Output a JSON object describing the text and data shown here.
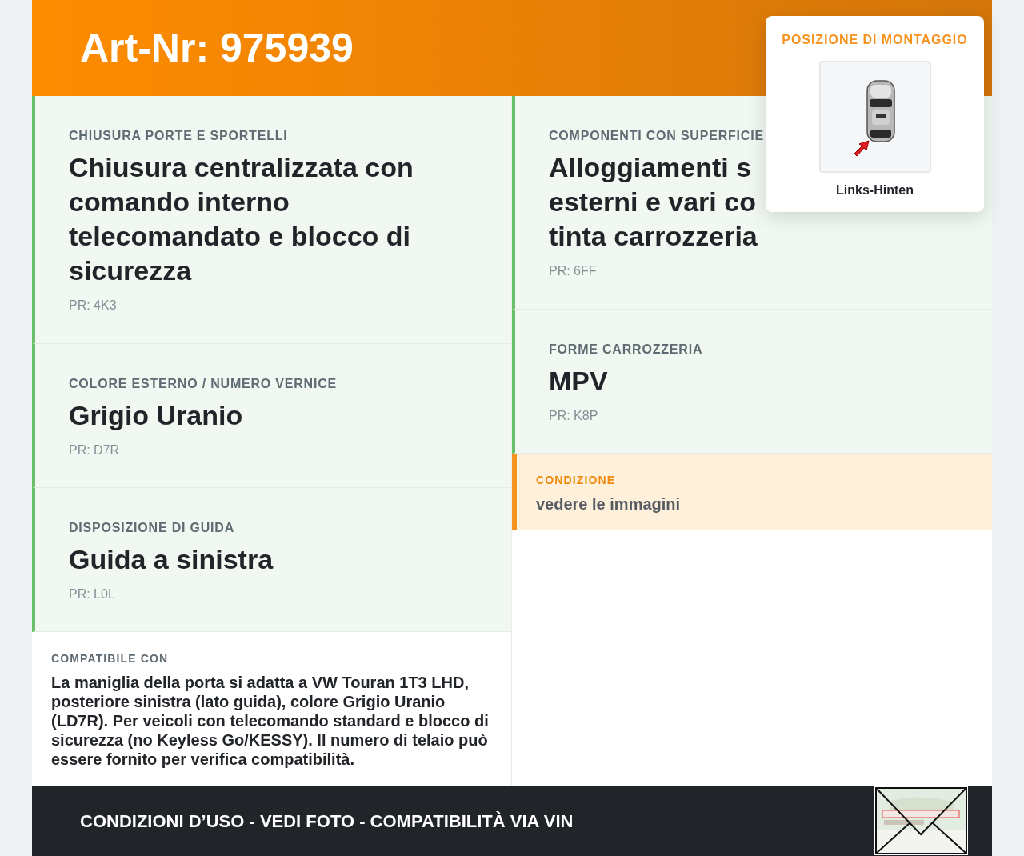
{
  "header": {
    "title": "Art-Nr: 975939"
  },
  "left_sections": [
    {
      "label": "CHIUSURA PORTE E SPORTELLI",
      "title_lines": [
        "Chiusura centralizzata con",
        "comando interno",
        "telecomandato e blocco di",
        "sicurezza"
      ],
      "code": "PR: 4K3"
    },
    {
      "label": "COLORE ESTERNO / NUMERO VERNICE",
      "title_lines": [
        "Grigio Uranio"
      ],
      "code": "PR: D7R"
    },
    {
      "label": "DISPOSIZIONE DI GUIDA",
      "title_lines": [
        "Guida a sinistra"
      ],
      "code": "PR: L0L"
    }
  ],
  "compatibility": {
    "label": "COMPATIBILE CON",
    "text": "La maniglia della porta si adatta a VW Touran 1T3 LHD, posteriore sinistra (lato guida), colore Grigio Uranio (LD7R). Per veicoli con telecomando standard e blocco di sicurezza (no Keyless Go/KESSY). Il numero di telaio può essere fornito per verifica compatibilità."
  },
  "right_sections": [
    {
      "label": "COMPONENTI CON SUPERFICIE",
      "title_lines": [
        "Alloggiamenti s",
        "esterni e vari co",
        "tinta carrozzeria"
      ],
      "code": "PR: 6FF"
    },
    {
      "label": "FORME CARROZZERIA",
      "title_lines": [
        "MPV"
      ],
      "code": "PR: K8P"
    }
  ],
  "condition": {
    "label": "CONDIZIONE",
    "text": "vedere le immagini"
  },
  "mounting_popup": {
    "title": "POSIZIONE DI MONTAGGIO",
    "position": "Links-Hinten"
  },
  "footer": {
    "text": "CONDIZIONI D’USO - VEDI FOTO - COMPATIBILITÀ VIA VIN"
  }
}
